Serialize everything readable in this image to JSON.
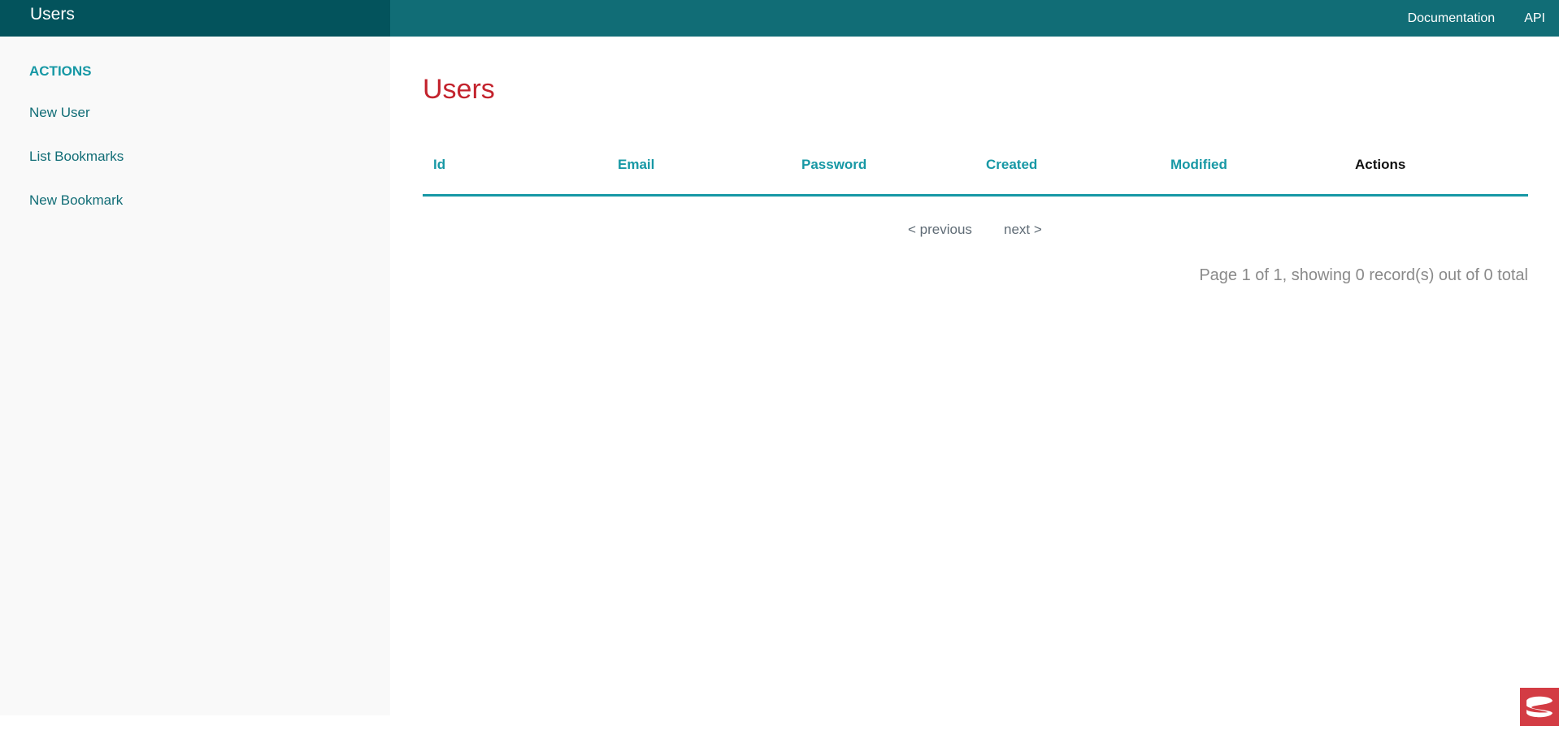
{
  "topbar": {
    "title": "Users",
    "links": [
      "Documentation",
      "API"
    ]
  },
  "sidebar": {
    "heading": "ACTIONS",
    "items": [
      "New User",
      "List Bookmarks",
      "New Bookmark"
    ]
  },
  "main": {
    "title": "Users",
    "table": {
      "headers": [
        "Id",
        "Email",
        "Password",
        "Created",
        "Modified",
        "Actions"
      ],
      "rows": []
    },
    "paging": {
      "previous": "< previous",
      "next": "next >"
    },
    "counter": "Page 1 of 1, showing 0 record(s) out of 0 total"
  },
  "colors": {
    "topbar": "#116d76",
    "topbar_title_bg": "#03535c",
    "sidebar_bg": "#f9f9f9",
    "link": "#1798a5",
    "title": "#c3232d",
    "logo": "#d33c44"
  },
  "icons": {
    "logo": "cakephp-logo-icon"
  }
}
